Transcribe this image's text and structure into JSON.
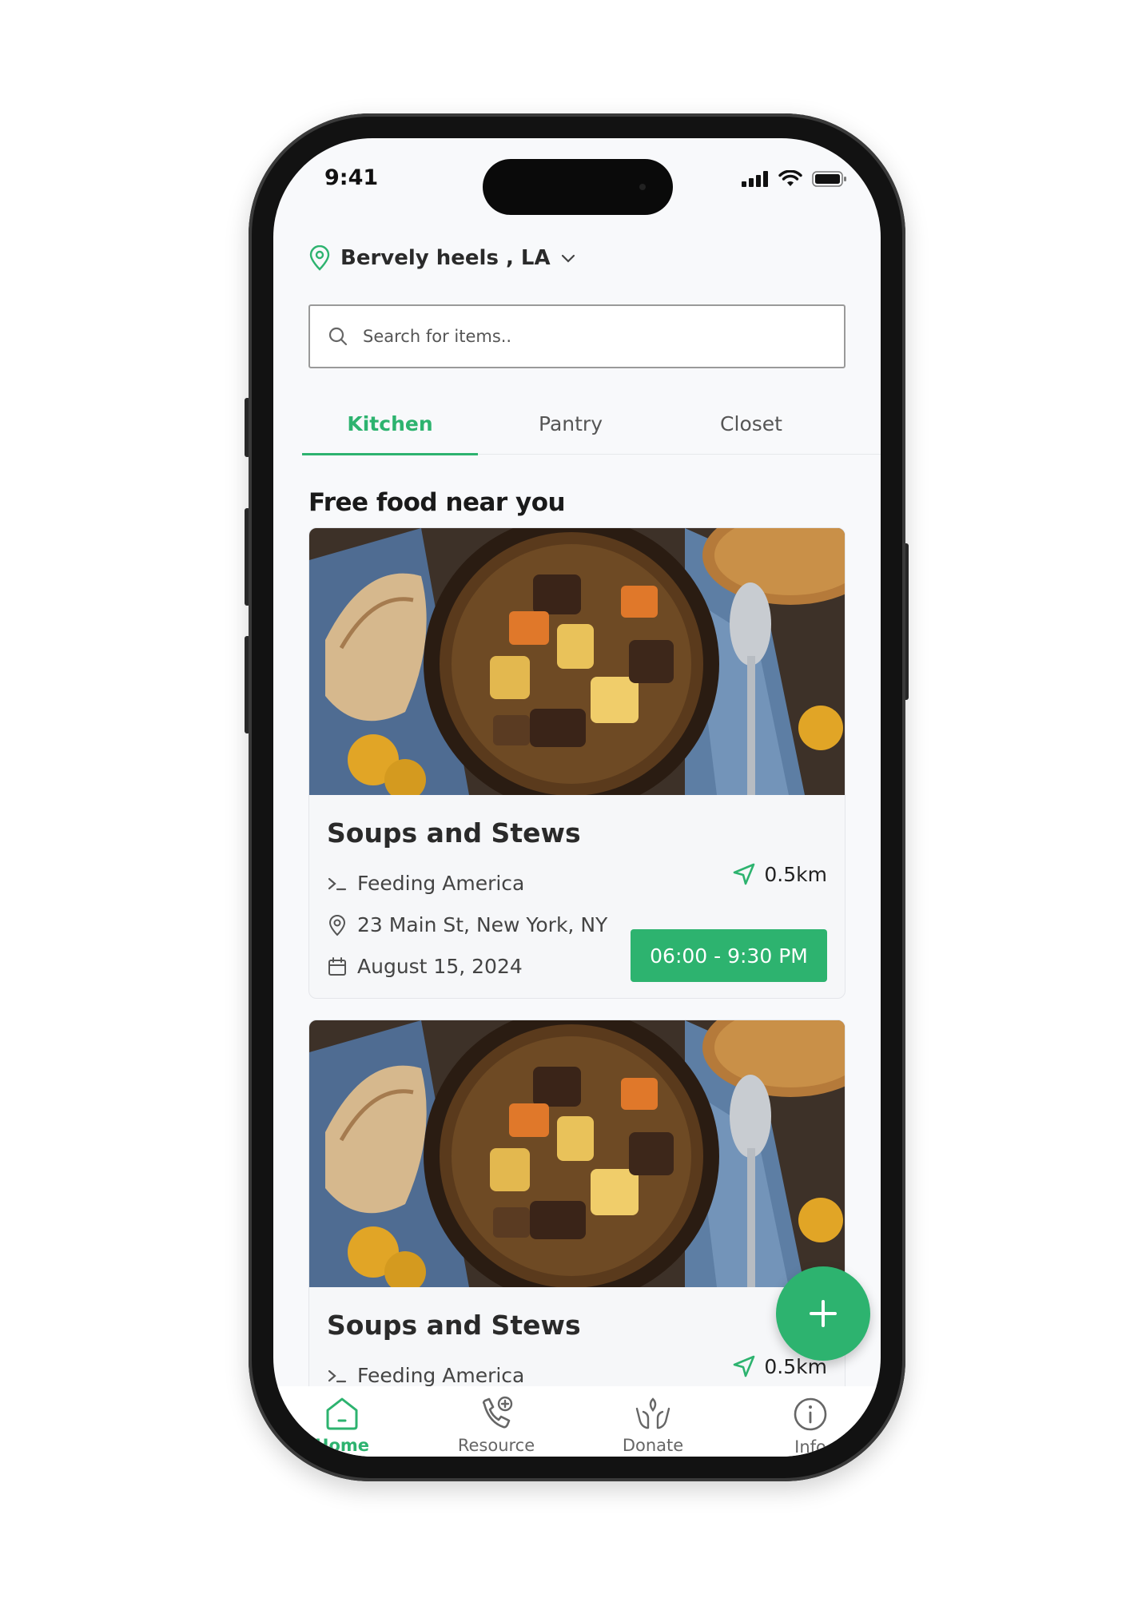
{
  "status_bar": {
    "time": "9:41"
  },
  "location": {
    "label": "Bervely heels , LA"
  },
  "search": {
    "placeholder": "Search for items.."
  },
  "tabs": [
    {
      "label": "Kitchen",
      "active": true
    },
    {
      "label": "Pantry",
      "active": false
    },
    {
      "label": "Closet",
      "active": false
    }
  ],
  "section_title": "Free food near you",
  "cards": [
    {
      "title": "Soups and Stews",
      "organization": "Feeding America",
      "address": "23 Main St, New York, NY",
      "date": "August 15, 2024",
      "distance": "0.5km",
      "hours": "06:00 - 9:30 PM"
    },
    {
      "title": "Soups and Stews",
      "organization": "Feeding America",
      "distance": "0.5km"
    }
  ],
  "bottom_nav": [
    {
      "label": "Home",
      "icon": "home-icon",
      "active": true
    },
    {
      "label": "Resource",
      "icon": "phone-plus-icon",
      "active": false
    },
    {
      "label": "Donate",
      "icon": "donate-hands-icon",
      "active": false
    },
    {
      "label": "Info",
      "icon": "info-icon",
      "active": false
    }
  ],
  "colors": {
    "accent": "#2db36f",
    "text": "#2a2a2a",
    "background": "#f8f9fb"
  }
}
